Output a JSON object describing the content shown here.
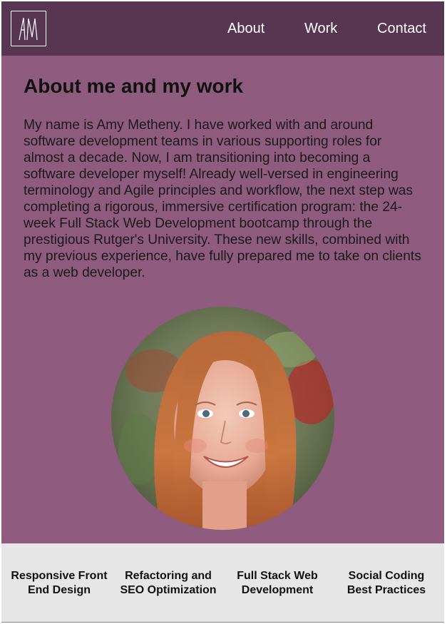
{
  "header": {
    "logo_text": "AM",
    "nav": [
      {
        "label": "About"
      },
      {
        "label": "Work"
      },
      {
        "label": "Contact"
      }
    ]
  },
  "main": {
    "title": "About me and my work",
    "bio": "My name is Amy Metheny. I have worked with and around software development teams in various supporting roles for almost a decade. Now, I am transitioning into becoming a software developer myself! Already well-versed in engineering terminology and Agile principles and workflow, the next step was completing a rigorous, immersive certification program: the 24-week Full Stack Web Development bootcamp through the prestigious Rutger's University. These new skills, combined with my previous experience, have fully prepared me to take on clients as a web developer."
  },
  "skills": [
    {
      "label": "Responsive Front End Design"
    },
    {
      "label": "Refactoring and SEO Optimization"
    },
    {
      "label": "Full Stack Web Development"
    },
    {
      "label": "Social Coding Best Practices"
    }
  ],
  "colors": {
    "header_bg": "#583651",
    "main_bg": "#8f5b7e",
    "skills_bg": "#e6e6e6"
  }
}
